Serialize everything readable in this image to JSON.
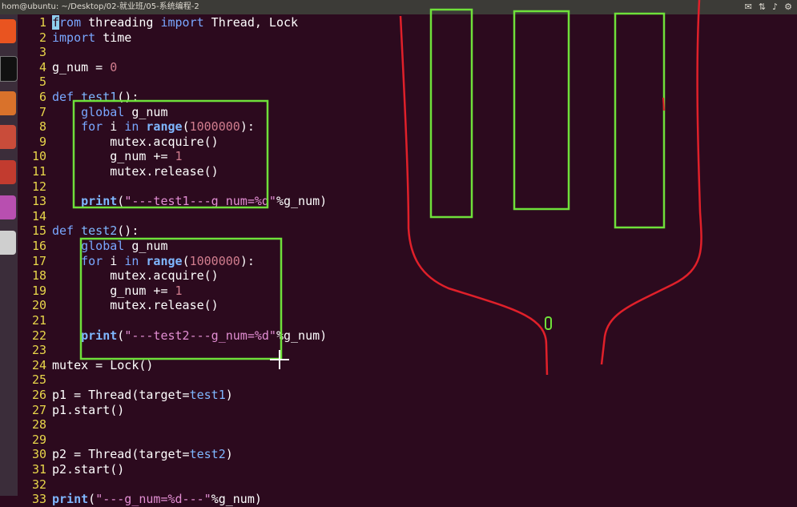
{
  "window": {
    "title": "hom@ubuntu: ~/Desktop/02-就业班/05-系统编程-2",
    "tray_icons": [
      "mail-icon",
      "network-icon",
      "volume-icon",
      "settings-icon"
    ]
  },
  "colors": {
    "background": "#2c0a1e",
    "line_numbers": "#e8d64a",
    "keyword": "#79a7ff",
    "builtin": "#7fb7ff",
    "string": "#e28ed3",
    "number": "#d17d8e",
    "annotation_green": "#6fe03a",
    "annotation_red": "#e0202a"
  },
  "editor": {
    "lines": [
      {
        "n": "1",
        "text": "from threading import Thread, Lock"
      },
      {
        "n": "2",
        "text": "import time"
      },
      {
        "n": "3",
        "text": ""
      },
      {
        "n": "4",
        "text": "g_num = 0"
      },
      {
        "n": "5",
        "text": ""
      },
      {
        "n": "6",
        "text": "def test1():"
      },
      {
        "n": "7",
        "text": "    global g_num"
      },
      {
        "n": "8",
        "text": "    for i in range(1000000):"
      },
      {
        "n": "9",
        "text": "        mutex.acquire()"
      },
      {
        "n": "10",
        "text": "        g_num += 1"
      },
      {
        "n": "11",
        "text": "        mutex.release()"
      },
      {
        "n": "12",
        "text": ""
      },
      {
        "n": "13",
        "text": "    print(\"---test1---g_num=%d\"%g_num)"
      },
      {
        "n": "14",
        "text": ""
      },
      {
        "n": "15",
        "text": "def test2():"
      },
      {
        "n": "16",
        "text": "    global g_num"
      },
      {
        "n": "17",
        "text": "    for i in range(1000000):"
      },
      {
        "n": "18",
        "text": "        mutex.acquire()"
      },
      {
        "n": "19",
        "text": "        g_num += 1"
      },
      {
        "n": "20",
        "text": "        mutex.release()"
      },
      {
        "n": "21",
        "text": ""
      },
      {
        "n": "22",
        "text": "    print(\"---test2---g_num=%d\"%g_num)"
      },
      {
        "n": "23",
        "text": ""
      },
      {
        "n": "24",
        "text": "mutex = Lock()"
      },
      {
        "n": "25",
        "text": ""
      },
      {
        "n": "26",
        "text": "p1 = Thread(target=test1)"
      },
      {
        "n": "27",
        "text": "p1.start()"
      },
      {
        "n": "28",
        "text": ""
      },
      {
        "n": "29",
        "text": ""
      },
      {
        "n": "30",
        "text": "p2 = Thread(target=test2)"
      },
      {
        "n": "31",
        "text": "p2.start()"
      },
      {
        "n": "32",
        "text": ""
      },
      {
        "n": "33",
        "text": "print(\"---g_num=%d---\"%g_num)"
      }
    ]
  }
}
